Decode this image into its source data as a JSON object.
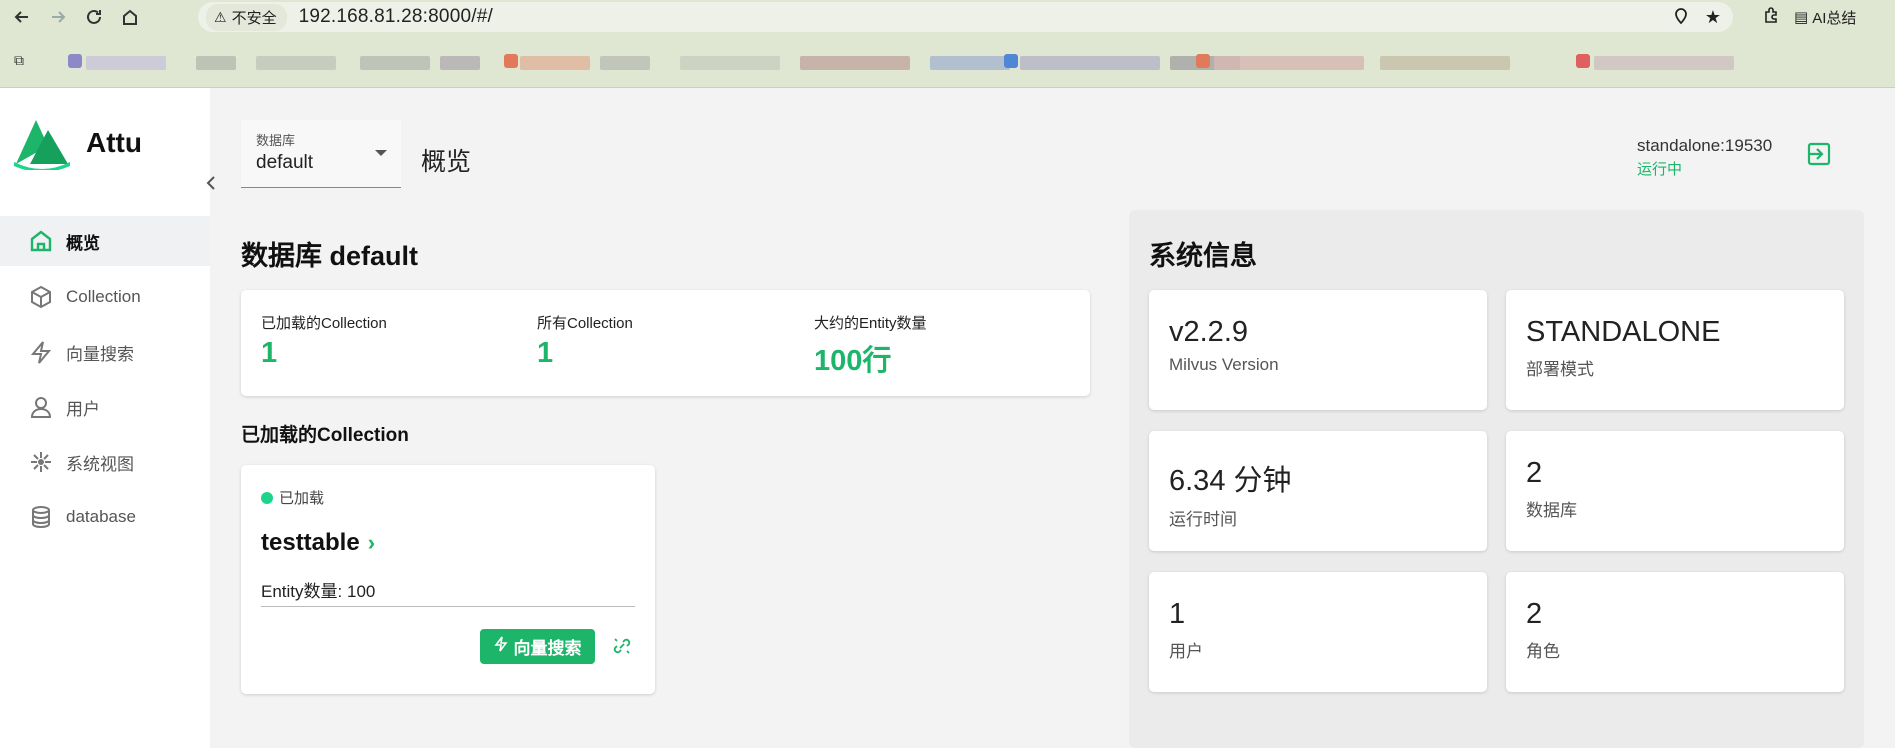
{
  "browser": {
    "address": {
      "insecure_label": "不安全",
      "url": "192.168.81.28:8000/#/"
    },
    "ai_summary_label": "AI总结",
    "icons": [
      "back-arrow-icon",
      "forward-arrow-icon",
      "reload-icon",
      "home-icon",
      "location-icon",
      "star-icon",
      "extensions-icon"
    ]
  },
  "sidebar": {
    "logo_text": "Attu",
    "items": [
      {
        "label": "概览",
        "icon": "home-icon",
        "active": true
      },
      {
        "label": "Collection",
        "icon": "cube-icon",
        "active": false
      },
      {
        "label": "向量搜索",
        "icon": "bolt-icon",
        "active": false
      },
      {
        "label": "用户",
        "icon": "user-icon",
        "active": false
      },
      {
        "label": "系统视图",
        "icon": "network-icon",
        "active": false
      },
      {
        "label": "database",
        "icon": "database-icon",
        "active": false
      }
    ]
  },
  "topbar": {
    "db_label": "数据库",
    "db_value": "default",
    "page_title": "概览",
    "connection": {
      "address": "standalone:19530",
      "status": "运行中"
    }
  },
  "main": {
    "db_title": "数据库 default",
    "stats": [
      {
        "label": "已加载的Collection",
        "value": "1"
      },
      {
        "label": "所有Collection",
        "value": "1"
      },
      {
        "label": "大约的Entity数量",
        "value": "100行"
      }
    ],
    "loaded_section_title": "已加载的Collection",
    "collection_card": {
      "status": "已加载",
      "name": "testtable",
      "entity_label": "Entity数量:",
      "entity_count": "100",
      "search_button": "向量搜索"
    }
  },
  "system": {
    "title": "系统信息",
    "cards": [
      {
        "value": "v2.2.9",
        "label": "Milvus Version"
      },
      {
        "value": "STANDALONE",
        "label": "部署模式"
      },
      {
        "value": "6.34 分钟",
        "label": "运行时间"
      },
      {
        "value": "2",
        "label": "数据库"
      },
      {
        "value": "1",
        "label": "用户"
      },
      {
        "value": "2",
        "label": "角色"
      }
    ]
  },
  "colors": {
    "accent": "#1cb569",
    "loaded_dot": "#1dd58a"
  }
}
